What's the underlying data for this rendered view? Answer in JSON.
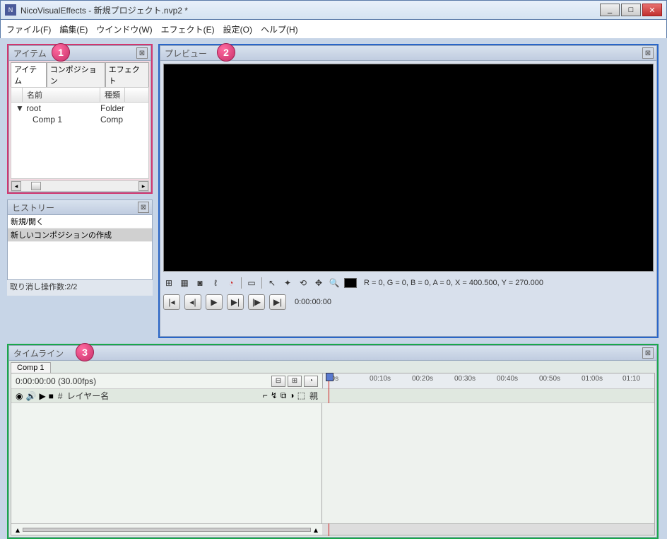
{
  "window": {
    "title": "NicoVisualEffects - 新規プロジェクト.nvp2 *"
  },
  "menu": {
    "file": "ファイル(F)",
    "edit": "編集(E)",
    "window": "ウインドウ(W)",
    "effect": "エフェクト(E)",
    "settings": "設定(O)",
    "help": "ヘルプ(H)"
  },
  "badges": {
    "b1": "1",
    "b2": "2",
    "b3": "3"
  },
  "items": {
    "title": "アイテム",
    "tabs": {
      "items": "アイテム",
      "composition": "コンポジション",
      "effect": "エフェクト"
    },
    "columns": {
      "name": "名前",
      "type": "種類"
    },
    "rows": [
      {
        "expander": "▼",
        "name": "root",
        "type": "Folder"
      },
      {
        "expander": "",
        "name": "Comp 1",
        "type": "Comp"
      }
    ]
  },
  "history": {
    "title": "ヒストリー",
    "rows": [
      "新規/開く",
      "新しいコンポジションの作成"
    ],
    "footer": "取り消し操作数:2/2"
  },
  "preview": {
    "title": "プレビュー",
    "status": "R = 0, G = 0, B = 0, A = 0, X = 400.500, Y = 270.000",
    "timecode": "0:00:00:00"
  },
  "timeline": {
    "title": "タイムライン",
    "tab": "Comp 1",
    "time_fps": "0:00:00:00 (30.00fps)",
    "cols": {
      "num": "#",
      "layer": "レイヤー名",
      "parent": "親"
    },
    "ticks": [
      "00s",
      "00:10s",
      "00:20s",
      "00:30s",
      "00:40s",
      "00:50s",
      "01:00s",
      "01:10"
    ]
  }
}
